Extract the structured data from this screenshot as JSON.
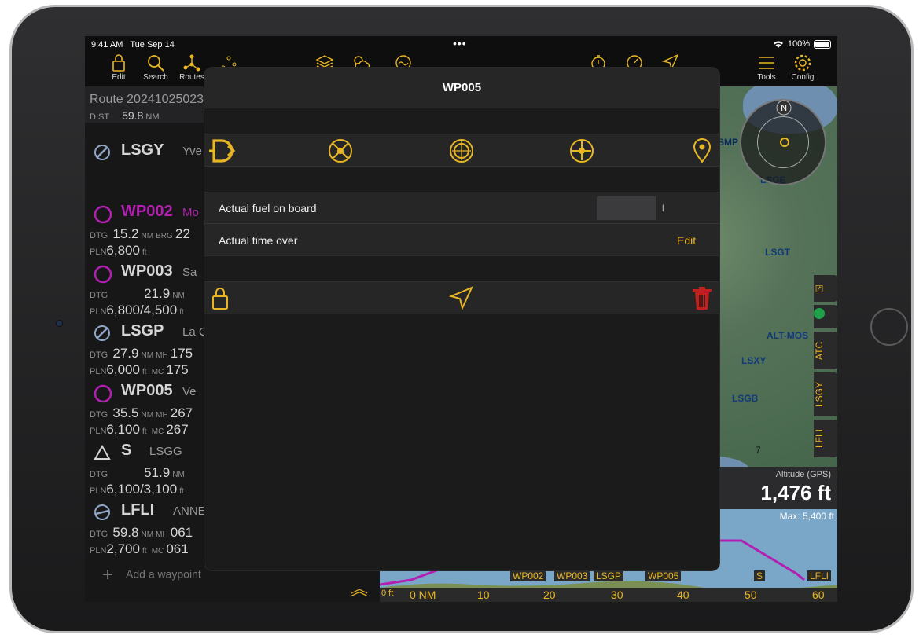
{
  "status_bar": {
    "time": "9:41 AM",
    "date": "Tue Sep 14",
    "dots": "•••",
    "battery": "100%"
  },
  "toolbar": {
    "left_items": [
      {
        "label": "Edit",
        "icon": "lock-icon"
      },
      {
        "label": "Search",
        "icon": "search-icon"
      },
      {
        "label": "Routes",
        "icon": "route-icon"
      }
    ],
    "right_items": [
      {
        "label": "Tools",
        "icon": "menu-icon"
      },
      {
        "label": "Config",
        "icon": "gear-icon"
      }
    ]
  },
  "route": {
    "name": "Route 20241025023",
    "dist_label": "DIST",
    "dist_value": "59.8",
    "dist_unit": "NM",
    "waypoints": [
      {
        "name": "LSGY",
        "desc": "Yve",
        "type": "airport"
      },
      {
        "name": "WP002",
        "desc": "Mo",
        "type": "waypoint",
        "active": true,
        "dtg": "15.2",
        "dtg_unit": "NM",
        "brg_label": "BRG",
        "brg": "22",
        "pln": "6,800",
        "pln_unit": "ft"
      },
      {
        "name": "WP003",
        "desc": "Sa",
        "type": "waypoint",
        "dtg": "21.9",
        "dtg_unit": "NM",
        "pln": "6,800/4,500",
        "pln_unit": "ft"
      },
      {
        "name": "LSGP",
        "desc": "La C",
        "type": "airport",
        "dtg": "27.9",
        "dtg_unit": "NM",
        "mh_label": "MH",
        "mh": "175",
        "pln": "6,000",
        "pln_unit": "ft",
        "mc_label": "MC",
        "mc": "175"
      },
      {
        "name": "WP005",
        "desc": "Ve",
        "type": "waypoint",
        "dtg": "35.5",
        "dtg_unit": "NM",
        "mh_label": "MH",
        "mh": "267",
        "pln": "6,100",
        "pln_unit": "ft",
        "mc_label": "MC",
        "mc": "267"
      },
      {
        "name": "S",
        "desc": "LSGG",
        "type": "reporting",
        "dtg": "51.9",
        "dtg_unit": "NM",
        "pln": "6,100/3,100",
        "pln_unit": "ft"
      },
      {
        "name": "LFLI",
        "desc": "ANNE",
        "type": "airport",
        "dtg": "59.8",
        "dtg_unit": "NM",
        "mh_label": "MH",
        "mh": "061",
        "pln": "2,700",
        "pln_unit": "ft",
        "mc_label": "MC",
        "mc": "061"
      }
    ],
    "dtg_label": "DTG",
    "pln_label": "PLN",
    "add_waypoint": "Add a waypoint"
  },
  "map": {
    "airports": [
      "LSGE",
      "LSGT",
      "LSXY",
      "LSGB",
      "ALT-MOS"
    ],
    "smp_label": "SMP",
    "side_tabs": [
      "ATC",
      "LSGY",
      "LFLI"
    ],
    "scale_label": "7",
    "altitude_label": "Altitude (GPS)",
    "altitude_value": "1,476 ft",
    "max_alt": "Max: 5,400 ft",
    "profile_labels": [
      "WP002",
      "WP003",
      "LSGP",
      "WP005",
      "S",
      "LFLI"
    ],
    "ruler": [
      "0 NM",
      "10",
      "20",
      "30",
      "40",
      "50",
      "60"
    ],
    "zero_ft": "0 ft"
  },
  "modal": {
    "title": "WP005",
    "icons": [
      "direct-to-icon",
      "crossed-waypoint-icon",
      "target-circle-icon",
      "crosshair-icon",
      "map-pin-icon"
    ],
    "fuel_label": "Actual fuel on board",
    "fuel_value": "",
    "fuel_unit": "l",
    "time_label": "Actual time over",
    "time_edit": "Edit",
    "actions": [
      "lock-icon",
      "navigate-icon",
      "trash-icon"
    ]
  },
  "colors": {
    "accent": "#e8b623",
    "active_waypoint": "#b21fb2",
    "delete": "#c0211e"
  }
}
